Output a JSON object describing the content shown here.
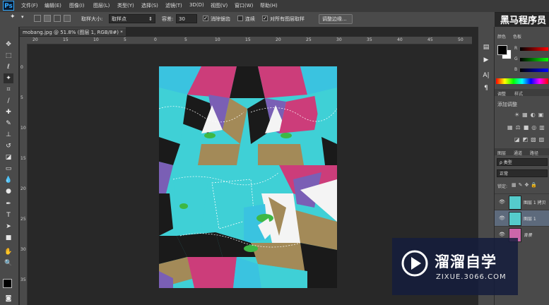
{
  "app": {
    "logo": "Ps",
    "brand_text": "黑马程序员"
  },
  "menu": [
    "文件(F)",
    "编辑(E)",
    "图像(I)",
    "图层(L)",
    "类型(Y)",
    "选择(S)",
    "滤镜(T)",
    "3D(D)",
    "视图(V)",
    "窗口(W)",
    "帮助(H)"
  ],
  "options": {
    "sample_size_label": "取样大小:",
    "sample_size_value": "取样点",
    "tolerance_label": "容差:",
    "tolerance_value": "30",
    "antialias_label": "消除锯齿",
    "antialias_checked": true,
    "contiguous_label": "连续",
    "contiguous_checked": false,
    "all_layers_label": "对所有图层取样",
    "all_layers_checked": true,
    "refine_edge_label": "调整边缘..."
  },
  "document": {
    "tab_title": "mobang.jpg @ 51.8% (图层 1, RGB/8#) *",
    "close": "×"
  },
  "rulers": {
    "h": [
      "20",
      "15",
      "10",
      "5",
      "0",
      "5",
      "10",
      "15",
      "20",
      "25",
      "30",
      "35",
      "40",
      "45",
      "50"
    ],
    "v": [
      "0",
      "5",
      "10",
      "15",
      "20",
      "25",
      "30",
      "35"
    ]
  },
  "panels": {
    "color_tab": "颜色",
    "swatches_tab": "色板",
    "channels": [
      "R",
      "G",
      "B"
    ],
    "adjust_tab": "调整",
    "style_tab": "样式",
    "add_adjust_label": "添加调整",
    "layers_tab": "图层",
    "channels_tab": "通道",
    "paths_tab": "路径",
    "kind_filter": "ρ 类型",
    "blend_mode": "正常",
    "lock_label": "锁定:",
    "layers": [
      {
        "name": "图层 1 拷贝"
      },
      {
        "name": "图层 1"
      },
      {
        "name": "背景"
      }
    ]
  },
  "watermark": {
    "title": "溜溜自学",
    "url": "ZIXUE.3066.COM"
  },
  "colors": {
    "fg": "#000000",
    "bg": "#ffffff",
    "accent": "#31a8ff"
  }
}
